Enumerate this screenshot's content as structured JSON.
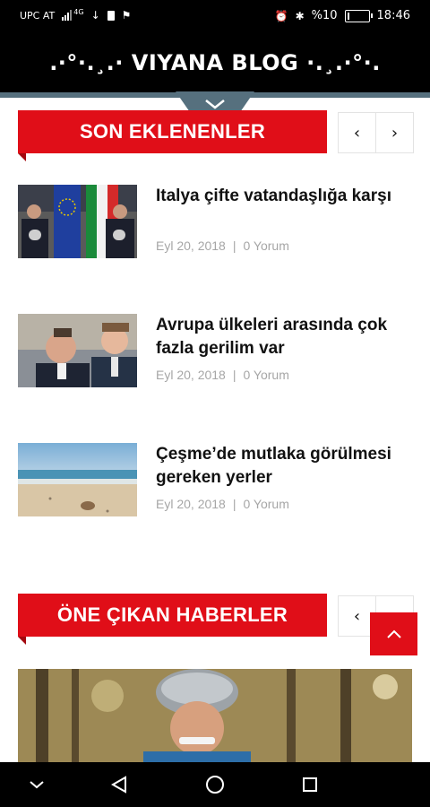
{
  "status_bar": {
    "carrier": "UPC AT",
    "signal_label": "4G",
    "battery_text": "%10",
    "battery_level": 0.1,
    "time": "18:46"
  },
  "header": {
    "title": ".·°·.¸.· VIYANA BLOG ·.¸.·°·."
  },
  "sections": {
    "recent": {
      "title": "SON EKLENENLER",
      "prev_icon": "‹",
      "next_icon": "›"
    },
    "featured": {
      "title": "ÖNE ÇIKAN HABERLER",
      "prev_icon": "‹",
      "next_icon": "›"
    }
  },
  "posts": [
    {
      "title": "Italya çifte vatandaşlığa karşı",
      "date": "Eyl 20, 2018",
      "separator": "|",
      "comments": "0 Yorum",
      "thumb_icon": "press-conference-photo"
    },
    {
      "title": "Avrupa ülkeleri arasında çok fazla gerilim var",
      "date": "Eyl 20, 2018",
      "separator": "|",
      "comments": "0 Yorum",
      "thumb_icon": "politicians-photo"
    },
    {
      "title": "Çeşme’de mutlaka görülmesi gereken yerler",
      "date": "Eyl 20, 2018",
      "separator": "|",
      "comments": "0 Yorum",
      "thumb_icon": "beach-photo"
    }
  ],
  "featured_image": {
    "icon": "cyclist-photo"
  },
  "colors": {
    "accent": "#e00e18",
    "header_bg": "#000000",
    "header_strip": "#56707e",
    "meta_text": "#a6a6a6"
  }
}
